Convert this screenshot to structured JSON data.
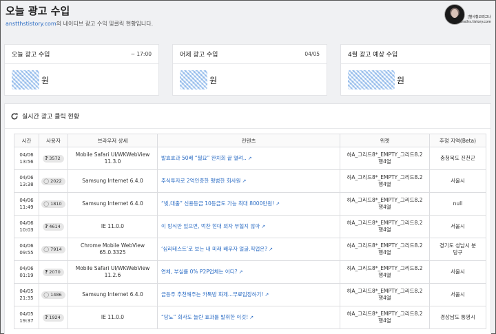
{
  "header": {
    "title": "오늘 광고 수입",
    "subtitle_link": "anstthstistory.com",
    "subtitle_text": "의 네이티브 광고 수익 및클릭 현황입니다.",
    "profile_name_line1": "[별사황코리고나",
    "profile_name_line2": "ansths.tistory.com"
  },
  "cards": [
    {
      "title": "오늘 광고 수입",
      "time": "~ 17:00",
      "unit": "원"
    },
    {
      "title": "어제 광고 수입",
      "time": "04/05",
      "unit": "원"
    },
    {
      "title": "4월 광고 예상 수입",
      "time": "",
      "unit": "원"
    }
  ],
  "clicks": {
    "title": "실시간 광고 클릭 현황",
    "columns": [
      "시간",
      "사용자",
      "브라우저 상세",
      "컨텐츠",
      "위젯",
      "추정 지역(Beta)"
    ],
    "rows": [
      {
        "date": "04/06",
        "time": "13:56",
        "user_icon": "question",
        "user": "3572",
        "browser1": "Mobile Safari UI/WKWebView",
        "browser2": "11.3.0",
        "content": "발효효과 50배 “필요” 완치회 끝 열려..",
        "widget1": "하A_그리드8*_EMPTY_그리드8.2",
        "widget2": "행4열",
        "region1": "충청북도 진천군",
        "region2": ""
      },
      {
        "date": "04/06",
        "time": "13:38",
        "user_icon": "chat",
        "user": "2022",
        "browser1": "Samsung Internet 6.4.0",
        "browser2": "",
        "content": "주식투자로 2억인증한 평범한 회사원",
        "widget1": "하A_그리드8*_EMPTY_그리드8.2",
        "widget2": "행4열",
        "region1": "서울시",
        "region2": ""
      },
      {
        "date": "04/06",
        "time": "11:49",
        "user_icon": "chat",
        "user": "1810",
        "browser1": "Samsung Internet 6.4.0",
        "browser2": "",
        "content": "“빚,대출” 신용등급 10등급도 가능 최대 8000만원!",
        "widget1": "하A_그리드8*_EMPTY_그리드8.2",
        "widget2": "행4열",
        "region1": "null",
        "region2": ""
      },
      {
        "date": "04/06",
        "time": "10:03",
        "user_icon": "question",
        "user": "4614",
        "browser1": "IE 11.0.0",
        "browser2": "",
        "content": "이 방식만 있으면, 벅찬 현대 외자 부협지 않아",
        "widget1": "하A_그리드8*_EMPTY_그리드8.2",
        "widget2": "행4열",
        "region1": "서울시",
        "region2": ""
      },
      {
        "date": "04/06",
        "time": "09:55",
        "user_icon": "chat",
        "user": "7914",
        "browser1": "Chrome Mobile WebView",
        "browser2": "65.0.3325",
        "content": "‘심리테스트’로 보는 내 미래 배우자 얼굴.직업은?",
        "widget1": "하A_그리드8*_EMPTY_그리드8.2",
        "widget2": "행4열",
        "region1": "경기도 성남시 분",
        "region2": "당구"
      },
      {
        "date": "04/06",
        "time": "01:19",
        "user_icon": "question",
        "user": "2070",
        "browser1": "Mobile Safari UI/WKWebView",
        "browser2": "11.2.6",
        "content": "연체, 부실률 0% P2P업체는 어디?",
        "widget1": "하A_그리드8*_EMPTY_그리드8.2",
        "widget2": "행4열",
        "region1": "서울시",
        "region2": ""
      },
      {
        "date": "04/05",
        "time": "21:35",
        "user_icon": "chat",
        "user": "1486",
        "browser1": "Samsung Internet 6.4.0",
        "browser2": "",
        "content": "급등주 추천해주는 카톡방 화제...무료입장하기!",
        "widget1": "하A_그리드8*_EMPTY_그리드8.2",
        "widget2": "행4열",
        "region1": "서울시",
        "region2": ""
      },
      {
        "date": "04/05",
        "time": "19:37",
        "user_icon": "question",
        "user": "1924",
        "browser1": "IE 11.0.0",
        "browser2": "",
        "content": "“당뇨” 회사도 놀란 효과를 발휘한 이것!",
        "widget1": "하A_그리드8*_EMPTY_그리드8.2",
        "widget2": "행4열",
        "region1": "경상남도 통영시",
        "region2": ""
      }
    ]
  }
}
